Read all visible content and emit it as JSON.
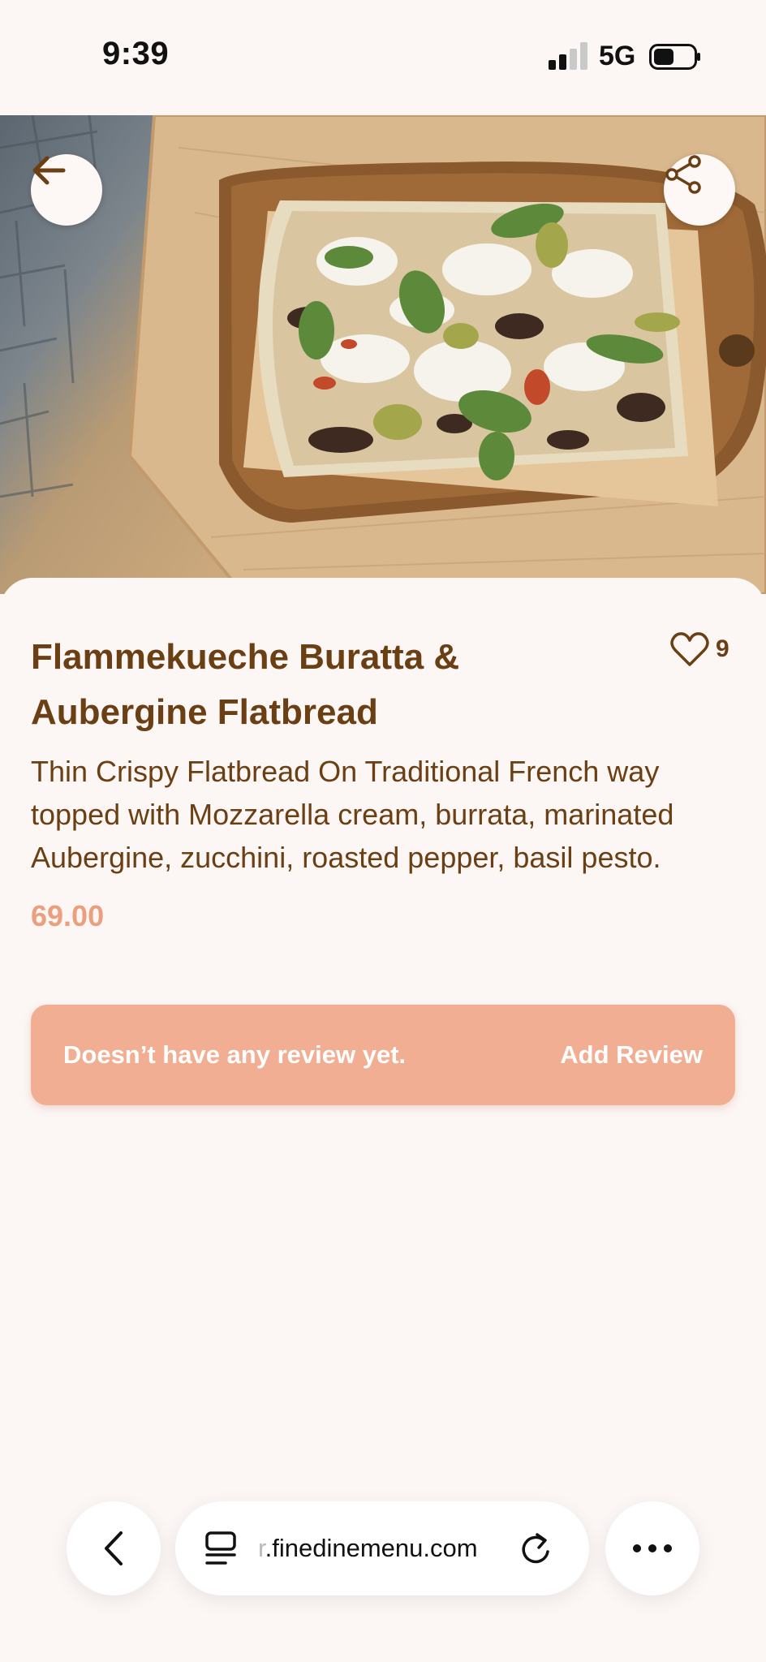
{
  "status_bar": {
    "time": "9:39",
    "network": "5G",
    "icons": [
      "signal-icon",
      "battery-icon"
    ]
  },
  "hero": {
    "back_icon": "arrow-left-icon",
    "share_icon": "share-icon",
    "image_subject": "flatbread-photo"
  },
  "item": {
    "title": "Flammekueche Buratta & Aubergine Flatbread",
    "like_count": "9",
    "like_icon": "heart-icon",
    "description": "Thin Crispy Flatbread On Traditional French way topped with Mozzarella cream, burrata, marinated Aubergine, zucchini, roasted pepper, basil pesto.",
    "price": "69.00"
  },
  "review": {
    "empty_text": "Doesn’t have any review yet.",
    "add_label": "Add Review"
  },
  "browser": {
    "url_prefix": "r",
    "url_rest": ".finedinemenu.com",
    "icons": [
      "chevron-left-icon",
      "tabs-icon",
      "reload-icon",
      "more-icon"
    ]
  },
  "colors": {
    "brown": "#6b3f14",
    "price": "#eaa07e",
    "review_bg": "#f2ae92",
    "background": "#fcf6f5"
  }
}
